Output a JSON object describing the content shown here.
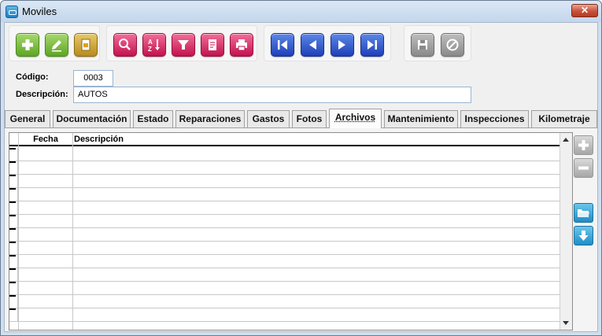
{
  "window": {
    "title": "Moviles",
    "close_label": "✕"
  },
  "toolbar": {
    "groups": [
      {
        "buttons": [
          {
            "icon": "add-icon",
            "color": "#5ea624"
          },
          {
            "icon": "edit-icon",
            "color": "#5ea624"
          },
          {
            "icon": "copy-icon",
            "color": "#b98b1e"
          }
        ]
      },
      {
        "buttons": [
          {
            "icon": "search-icon",
            "color": "#c2124f"
          },
          {
            "icon": "sort-az-icon",
            "color": "#c2124f"
          },
          {
            "icon": "filter-icon",
            "color": "#c2124f"
          },
          {
            "icon": "report-icon",
            "color": "#c2124f"
          },
          {
            "icon": "print-icon",
            "color": "#c2124f"
          }
        ]
      },
      {
        "buttons": [
          {
            "icon": "first-record-icon",
            "color": "#1f3fb8"
          },
          {
            "icon": "previous-record-icon",
            "color": "#1f3fb8"
          },
          {
            "icon": "next-record-icon",
            "color": "#1f3fb8"
          },
          {
            "icon": "last-record-icon",
            "color": "#1f3fb8"
          }
        ]
      },
      {
        "buttons": [
          {
            "icon": "save-icon",
            "color": "#8a8a8a"
          },
          {
            "icon": "cancel-icon",
            "color": "#8a8a8a"
          }
        ]
      }
    ]
  },
  "form": {
    "codigo_label": "Código:",
    "codigo_value": "0003",
    "descripcion_label": "Descripción:",
    "descripcion_value": "AUTOS"
  },
  "tabs": [
    {
      "label": "General"
    },
    {
      "label": "Documentación"
    },
    {
      "label": "Estado"
    },
    {
      "label": "Reparaciones"
    },
    {
      "label": "Gastos"
    },
    {
      "label": "Fotos"
    },
    {
      "label": "Archivos",
      "active": true
    },
    {
      "label": "Mantenimiento"
    },
    {
      "label": "Inspecciones"
    },
    {
      "label": "Kilometraje"
    }
  ],
  "grid": {
    "columns": [
      "Fecha",
      "Descripción"
    ],
    "rows": []
  },
  "side_buttons": [
    {
      "icon": "add-row-icon"
    },
    {
      "icon": "remove-row-icon"
    },
    {
      "icon": "open-folder-icon"
    },
    {
      "icon": "download-icon"
    }
  ]
}
